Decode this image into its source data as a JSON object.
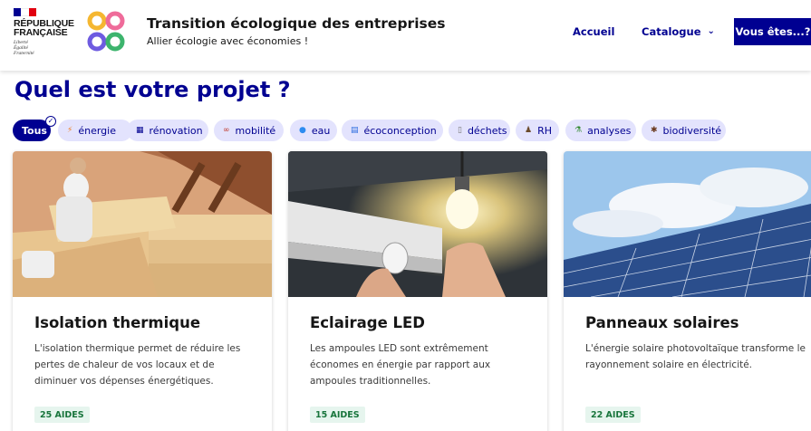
{
  "header": {
    "republique_line1": "RÉPUBLIQUE",
    "republique_line2": "FRANÇAISE",
    "devise": [
      "Liberté",
      "Égalité",
      "Fraternité"
    ],
    "site_title": "Transition écologique des entreprises",
    "site_tagline": "Allier écologie avec économies !",
    "nav": {
      "home": "Accueil",
      "catalog": "Catalogue",
      "cta": "Vous êtes...?"
    },
    "colors": {
      "flag_blue": "#000091",
      "flag_white": "#ffffff",
      "flag_red": "#e1000f"
    }
  },
  "page_title": "Quel est votre projet ?",
  "filters": [
    {
      "label": "Tous",
      "icon": "check-circle-icon",
      "active": true
    },
    {
      "label": "énergie",
      "icon": "lightning-icon",
      "active": false
    },
    {
      "label": "rénovation",
      "icon": "building-icon",
      "active": false
    },
    {
      "label": "mobilité",
      "icon": "bicycle-icon",
      "active": false
    },
    {
      "label": "eau",
      "icon": "water-drop-icon",
      "active": false
    },
    {
      "label": "écoconception",
      "icon": "document-icon",
      "active": false
    },
    {
      "label": "déchets",
      "icon": "bin-icon",
      "active": false
    },
    {
      "label": "RH",
      "icon": "person-icon",
      "active": false
    },
    {
      "label": "analyses",
      "icon": "microscope-icon",
      "active": false
    },
    {
      "label": "biodiversité",
      "icon": "bug-icon",
      "active": false
    }
  ],
  "cards": [
    {
      "title": "Isolation thermique",
      "description": "L'isolation thermique permet de réduire les pertes de chaleur de vos locaux et de diminuer vos dépenses énergétiques.",
      "badge": "25 AIDES"
    },
    {
      "title": "Eclairage LED",
      "description": "Les ampoules LED sont extrêmement économes en énergie par rapport aux ampoules traditionnelles.",
      "badge": "15 AIDES"
    },
    {
      "title": "Panneaux solaires",
      "description": "L'énergie solaire photovoltaïque transforme le rayonnement solaire en électricité.",
      "badge": "22 AIDES"
    }
  ],
  "colors": {
    "primary": "#000091",
    "chip_bg": "#e3e3fd",
    "badge_bg": "#e6f5ee",
    "badge_text": "#18753c"
  }
}
